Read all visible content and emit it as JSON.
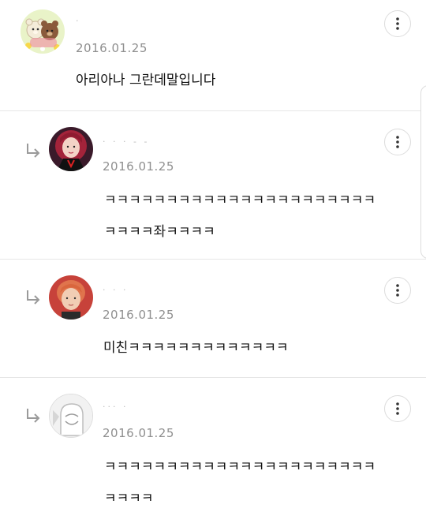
{
  "comments": [
    {
      "username": "·",
      "date": "2016.01.25",
      "text": "아리아나 그란데말입니다",
      "is_reply": false,
      "avatar": "bear-pair-avatar"
    },
    {
      "username": "· ·  ·  -  -",
      "date": "2016.01.25",
      "text": "ㅋㅋㅋㅋㅋㅋㅋㅋㅋㅋㅋㅋㅋㅋㅋㅋㅋㅋㅋㅋㅋㅋㅋㅋㅋㅋ좌ㅋㅋㅋㅋ",
      "is_reply": true,
      "avatar": "red-hair-portrait-avatar"
    },
    {
      "username": "·   ·   ·",
      "date": "2016.01.25",
      "text": "미친ㅋㅋㅋㅋㅋㅋㅋㅋㅋㅋㅋㅋㅋ",
      "is_reply": true,
      "avatar": "portrait-avatar"
    },
    {
      "username": "··· ·",
      "date": "2016.01.25",
      "text": "ㅋㅋㅋㅋㅋㅋㅋㅋㅋㅋㅋㅋㅋㅋㅋㅋㅋㅋㅋㅋㅋㅋㅋㅋㅋㅋ",
      "is_reply": true,
      "avatar": "default-ghost-avatar"
    }
  ],
  "icons": {
    "more": "more-vertical-icon",
    "reply": "reply-arrow-icon"
  },
  "colors": {
    "date": "#8f8f8f",
    "divider": "#e6e6e6",
    "text": "#111111"
  }
}
